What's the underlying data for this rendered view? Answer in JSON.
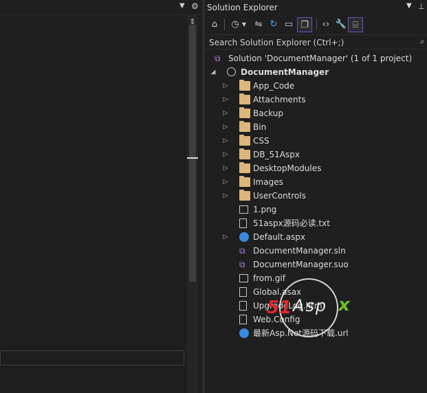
{
  "solution_explorer": {
    "title": "Solution Explorer",
    "search_placeholder": "Search Solution Explorer (Ctrl+;)",
    "solution_label": "Solution 'DocumentManager' (1 of 1 project)",
    "project_label": "DocumentManager",
    "items": [
      {
        "label": "App_Code",
        "icon": "folder-icon",
        "expandable": true
      },
      {
        "label": "Attachments",
        "icon": "folder-icon",
        "expandable": true
      },
      {
        "label": "Backup",
        "icon": "folder-icon",
        "expandable": true
      },
      {
        "label": "Bin",
        "icon": "folder-icon",
        "expandable": true
      },
      {
        "label": "CSS",
        "icon": "folder-icon",
        "expandable": true
      },
      {
        "label": "DB_51Aspx",
        "icon": "folder-icon",
        "expandable": true
      },
      {
        "label": "DesktopModules",
        "icon": "folder-icon",
        "expandable": true
      },
      {
        "label": "Images",
        "icon": "folder-icon",
        "expandable": true
      },
      {
        "label": "UserControls",
        "icon": "folder-icon",
        "expandable": true
      },
      {
        "label": "1.png",
        "icon": "image-file-icon",
        "expandable": false
      },
      {
        "label": "51aspx源码必读.txt",
        "icon": "text-file-icon",
        "expandable": false
      },
      {
        "label": "Default.aspx",
        "icon": "web-page-icon",
        "expandable": true
      },
      {
        "label": "DocumentManager.sln",
        "icon": "solution-file-icon",
        "expandable": false
      },
      {
        "label": "DocumentManager.suo",
        "icon": "suo-file-icon",
        "expandable": false
      },
      {
        "label": "from.gif",
        "icon": "image-file-icon",
        "expandable": false
      },
      {
        "label": "Global.asax",
        "icon": "global-file-icon",
        "expandable": false
      },
      {
        "label": "UpgradeLog.htm",
        "icon": "html-file-icon",
        "expandable": false
      },
      {
        "label": "Web.Config",
        "icon": "config-file-icon",
        "expandable": false
      },
      {
        "label": "最新Asp.Net源码下载.url",
        "icon": "url-file-icon",
        "expandable": false
      }
    ]
  },
  "watermark": {
    "part1": "51",
    "part2": "Asp",
    "part3": "x"
  },
  "colors": {
    "background": "#1e1e1e",
    "accent": "#6e4fbf",
    "folder": "#dcb67a"
  }
}
